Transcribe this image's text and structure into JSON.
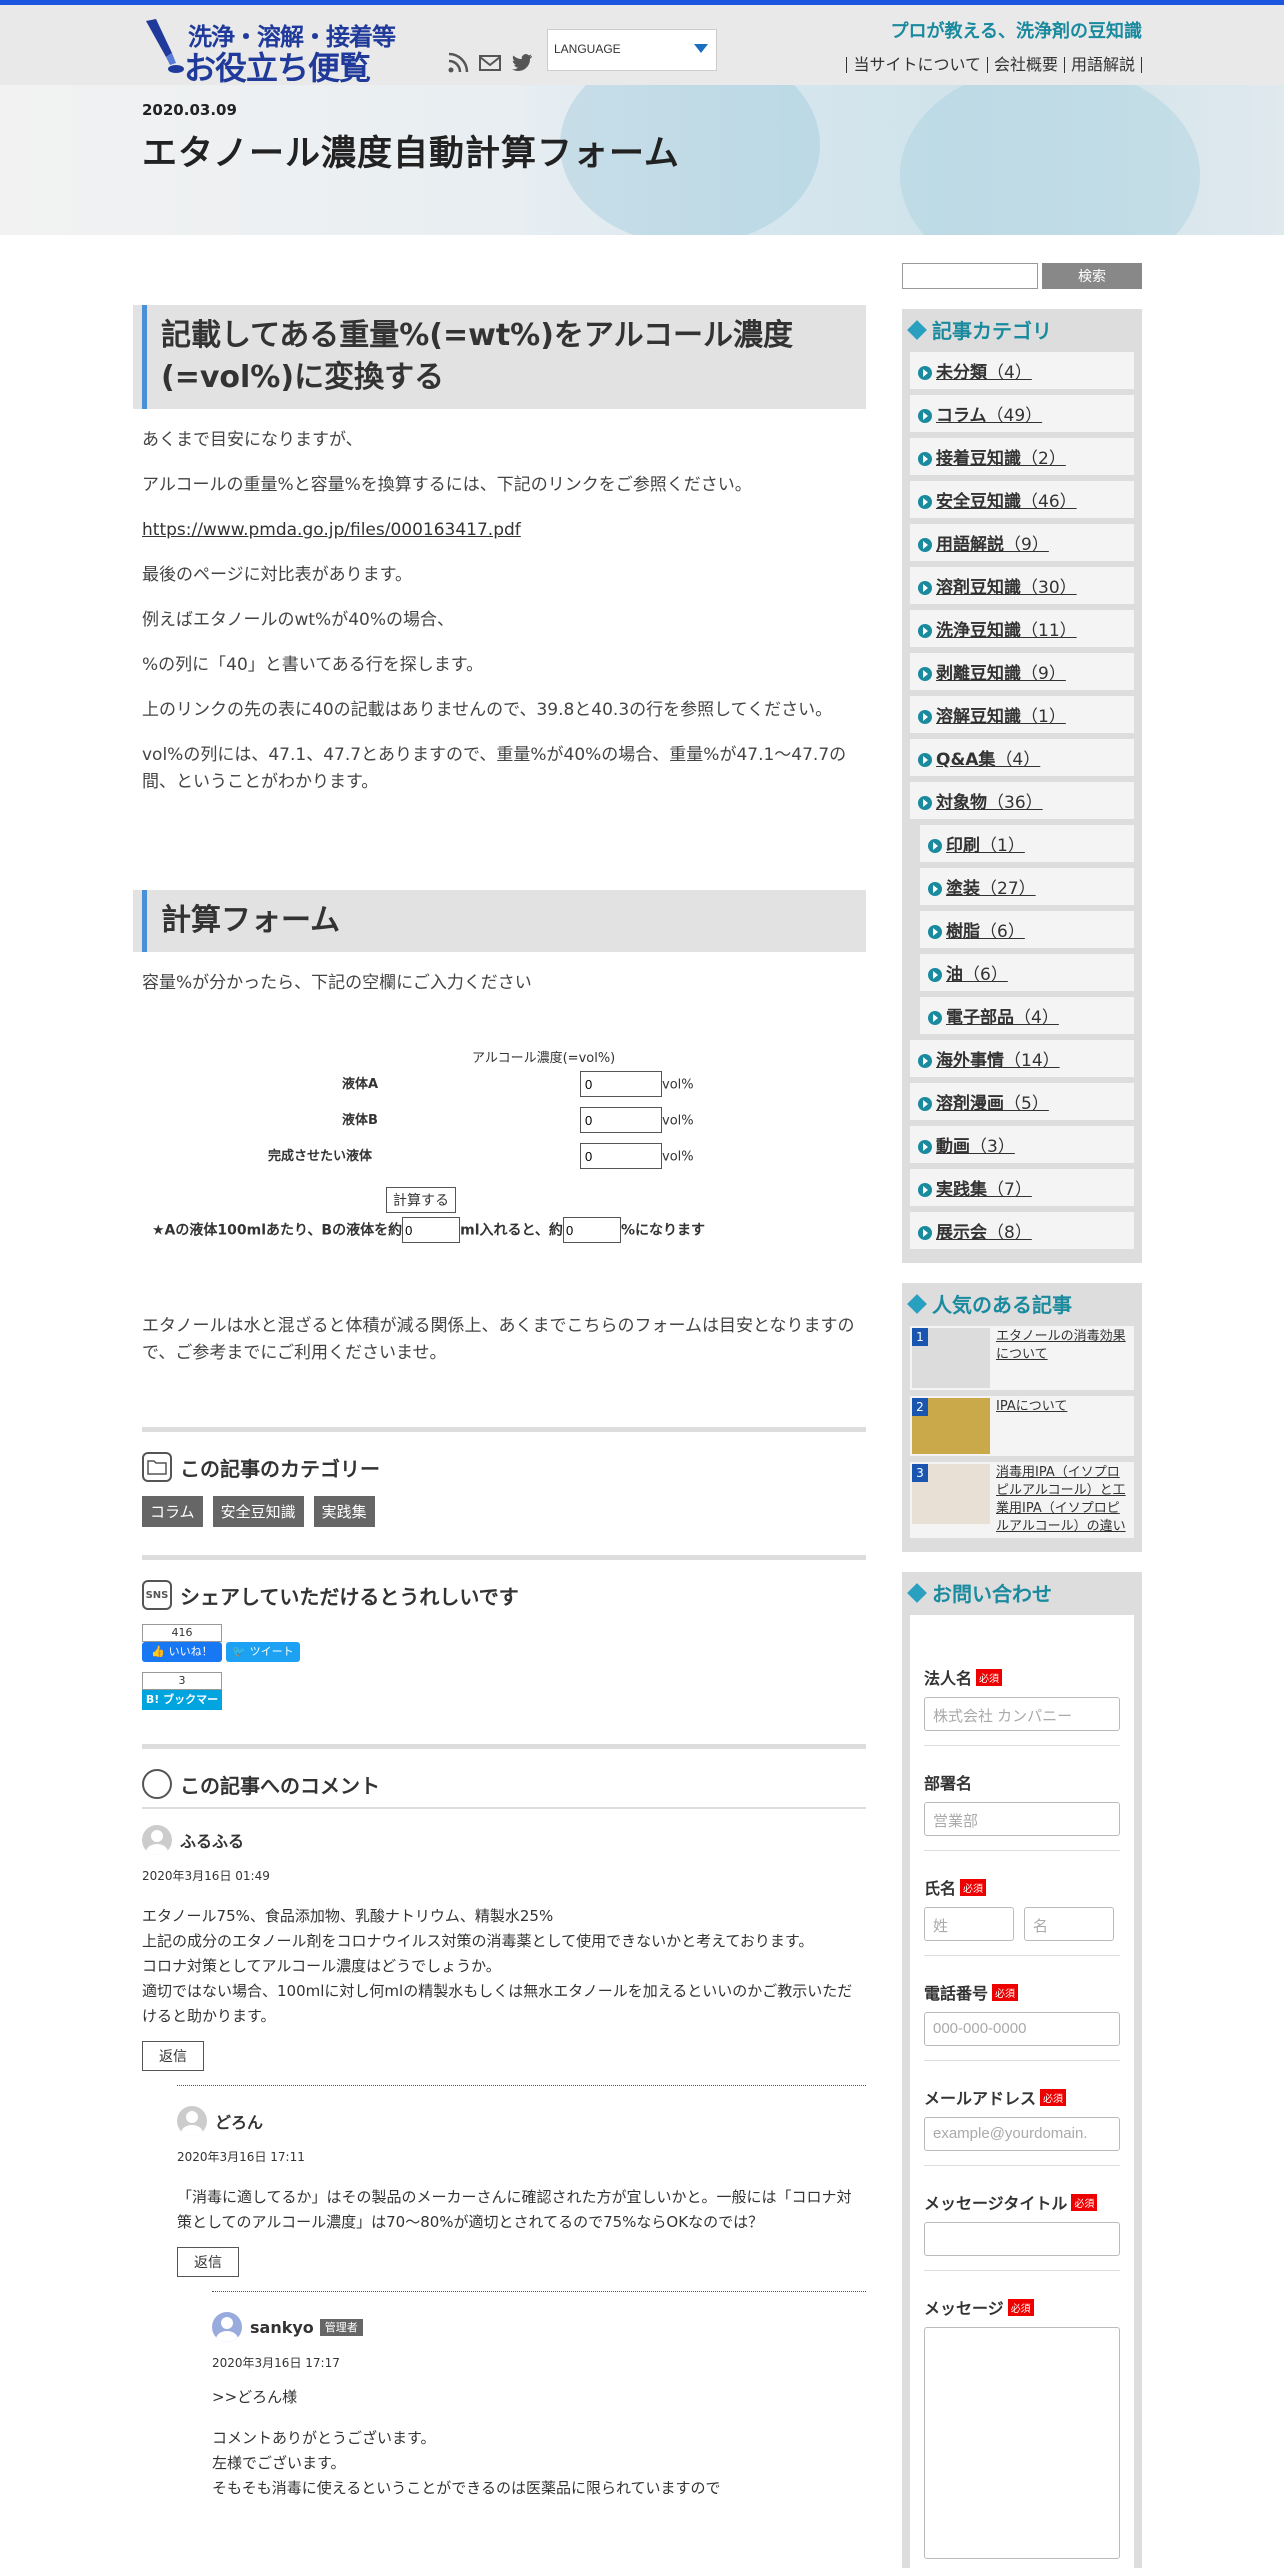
{
  "header": {
    "logo_line1": "洗浄・溶解・接着等",
    "logo_line2": "お役立ち便覧",
    "tagline": "プロが教える、洗浄剤の豆知識",
    "language": "LANGUAGE",
    "nav": [
      "当サイトについて",
      "会社概要",
      "用語解説"
    ]
  },
  "post": {
    "date": "2020.03.09",
    "title": "エタノール濃度自動計算フォーム"
  },
  "article": {
    "h2_1": "記載してある重量%(=wt%)をアルコール濃度(=vol%)に変換する",
    "p1": "あくまで目安になりますが、",
    "p2": "アルコールの重量%と容量%を換算するには、下記のリンクをご参照ください。",
    "link": "https://www.pmda.go.jp/files/000163417.pdf",
    "p3": "最後のページに対比表があります。",
    "p4": "例えばエタノールのwt%が40%の場合、",
    "p5": "%の列に「40」と書いてある行を探します。",
    "p6": "上のリンクの先の表に40の記載はありませんので、39.8と40.3の行を参照してください。",
    "p7": "vol%の列には、47.1、47.7とありますので、重量%が40%の場合、重量%が47.1～47.7の間、ということがわかります。",
    "h2_2": "計算フォーム",
    "p8": "容量%が分かったら、下記の空欄にご入力ください",
    "form": {
      "caption": "アルコール濃度(=vol%)",
      "rows": [
        {
          "label": "液体A",
          "value": "0",
          "unit": "vol%"
        },
        {
          "label": "液体B",
          "value": "0",
          "unit": "vol%"
        },
        {
          "label": "完成させたい液体",
          "value": "0",
          "unit": "vol%"
        }
      ],
      "button": "計算する",
      "result_pre": "★Aの液体100mlあたり、Bの液体を約",
      "result_val1": "0",
      "result_mid": "ml入れると、約",
      "result_val2": "0",
      "result_post": "%になります"
    },
    "p9": "エタノールは水と混ざると体積が減る関係上、あくまでこちらのフォームは目安となりますので、ご参考までにご利用くださいませ。"
  },
  "category_section": {
    "title": "この記事のカテゴリー",
    "tags": [
      "コラム",
      "安全豆知識",
      "実践集"
    ]
  },
  "share_section": {
    "icon_text": "SNS",
    "title": "シェアしていただけるとうれしいです",
    "fb_count": "416",
    "fb_label": "いいね！",
    "tw_label": "ツイート",
    "hb_count": "3",
    "hb_label": "B! ブックマーク"
  },
  "comments": {
    "title": "この記事へのコメント",
    "reply_label": "返信",
    "items": [
      {
        "name": "ふるふる",
        "date": "2020年3月16日 01:49",
        "lines": [
          "エタノール75%、食品添加物、乳酸ナトリウム、精製水25%",
          "上記の成分のエタノール剤をコロナウイルス対策の消毒薬として使用できないかと考えております。",
          "コロナ対策としてアルコール濃度はどうでしょうか。",
          "適切ではない場合、100mlに対し何mlの精製水もしくは無水エタノールを加えるといいのかご教示いただけると助かります。"
        ]
      },
      {
        "name": "どろん",
        "date": "2020年3月16日 17:11",
        "lines": [
          "「消毒に適してるか」はその製品のメーカーさんに確認された方が宜しいかと。一般には「コロナ対策としてのアルコール濃度」は70～80%が適切とされてるので75%ならOKなのでは？"
        ]
      },
      {
        "name": "sankyo",
        "badge": "管理者",
        "date": "2020年3月16日 17:17",
        "lines": [
          ">>どろん様",
          "コメントありがとうございます。",
          "左様でございます。",
          "そもそも消毒に使えるということができるのは医薬品に限られていますので"
        ]
      }
    ]
  },
  "sidebar": {
    "search_button": "検索",
    "categories_title": "記事カテゴリ",
    "categories": [
      {
        "label": "未分類",
        "count": "（4）",
        "sub": false
      },
      {
        "label": "コラム",
        "count": "（49）",
        "sub": false
      },
      {
        "label": "接着豆知識",
        "count": "（2）",
        "sub": false
      },
      {
        "label": "安全豆知識",
        "count": "（46）",
        "sub": false
      },
      {
        "label": "用語解説",
        "count": "（9）",
        "sub": false
      },
      {
        "label": "溶剤豆知識",
        "count": "（30）",
        "sub": false
      },
      {
        "label": "洗浄豆知識",
        "count": "（11）",
        "sub": false
      },
      {
        "label": "剥離豆知識",
        "count": "（9）",
        "sub": false
      },
      {
        "label": "溶解豆知識",
        "count": "（1）",
        "sub": false
      },
      {
        "label": "Q&A集",
        "count": "（4）",
        "sub": false
      },
      {
        "label": "対象物",
        "count": "（36）",
        "sub": false
      },
      {
        "label": "印刷",
        "count": "（1）",
        "sub": true
      },
      {
        "label": "塗装",
        "count": "（27）",
        "sub": true
      },
      {
        "label": "樹脂",
        "count": "（6）",
        "sub": true
      },
      {
        "label": "油",
        "count": "（6）",
        "sub": true
      },
      {
        "label": "電子部品",
        "count": "（4）",
        "sub": true
      },
      {
        "label": "海外事情",
        "count": "（14）",
        "sub": false
      },
      {
        "label": "溶剤漫画",
        "count": "（5）",
        "sub": false
      },
      {
        "label": "動画",
        "count": "（3）",
        "sub": false
      },
      {
        "label": "実践集",
        "count": "（7）",
        "sub": false
      },
      {
        "label": "展示会",
        "count": "（8）",
        "sub": false
      }
    ],
    "popular_title": "人気のある記事",
    "popular": [
      {
        "rank": "1",
        "title": "エタノールの消毒効果について"
      },
      {
        "rank": "2",
        "title": "IPAについて"
      },
      {
        "rank": "3",
        "title": "消毒用IPA（イソプロピルアルコール）と工業用IPA（イソプロピルアルコール）の違い"
      }
    ],
    "contact_title": "お問い合わせ",
    "contact": {
      "required": "必須",
      "company_label": "法人名",
      "company_ph": "株式会社 カンパニー",
      "dept_label": "部署名",
      "dept_ph": "営業部",
      "name_label": "氏名",
      "last_ph": "姓",
      "first_ph": "名",
      "tel_label": "電話番号",
      "tel_ph": "000-000-0000",
      "mail_label": "メールアドレス",
      "mail_ph": "example@yourdomain.",
      "subject_label": "メッセージタイトル",
      "message_label": "メッセージ"
    }
  },
  "colors": {
    "accent": "#1a8a9e",
    "topbar": "#1a56e0",
    "logo": "#1f3a9a",
    "required": "#ee0000"
  }
}
